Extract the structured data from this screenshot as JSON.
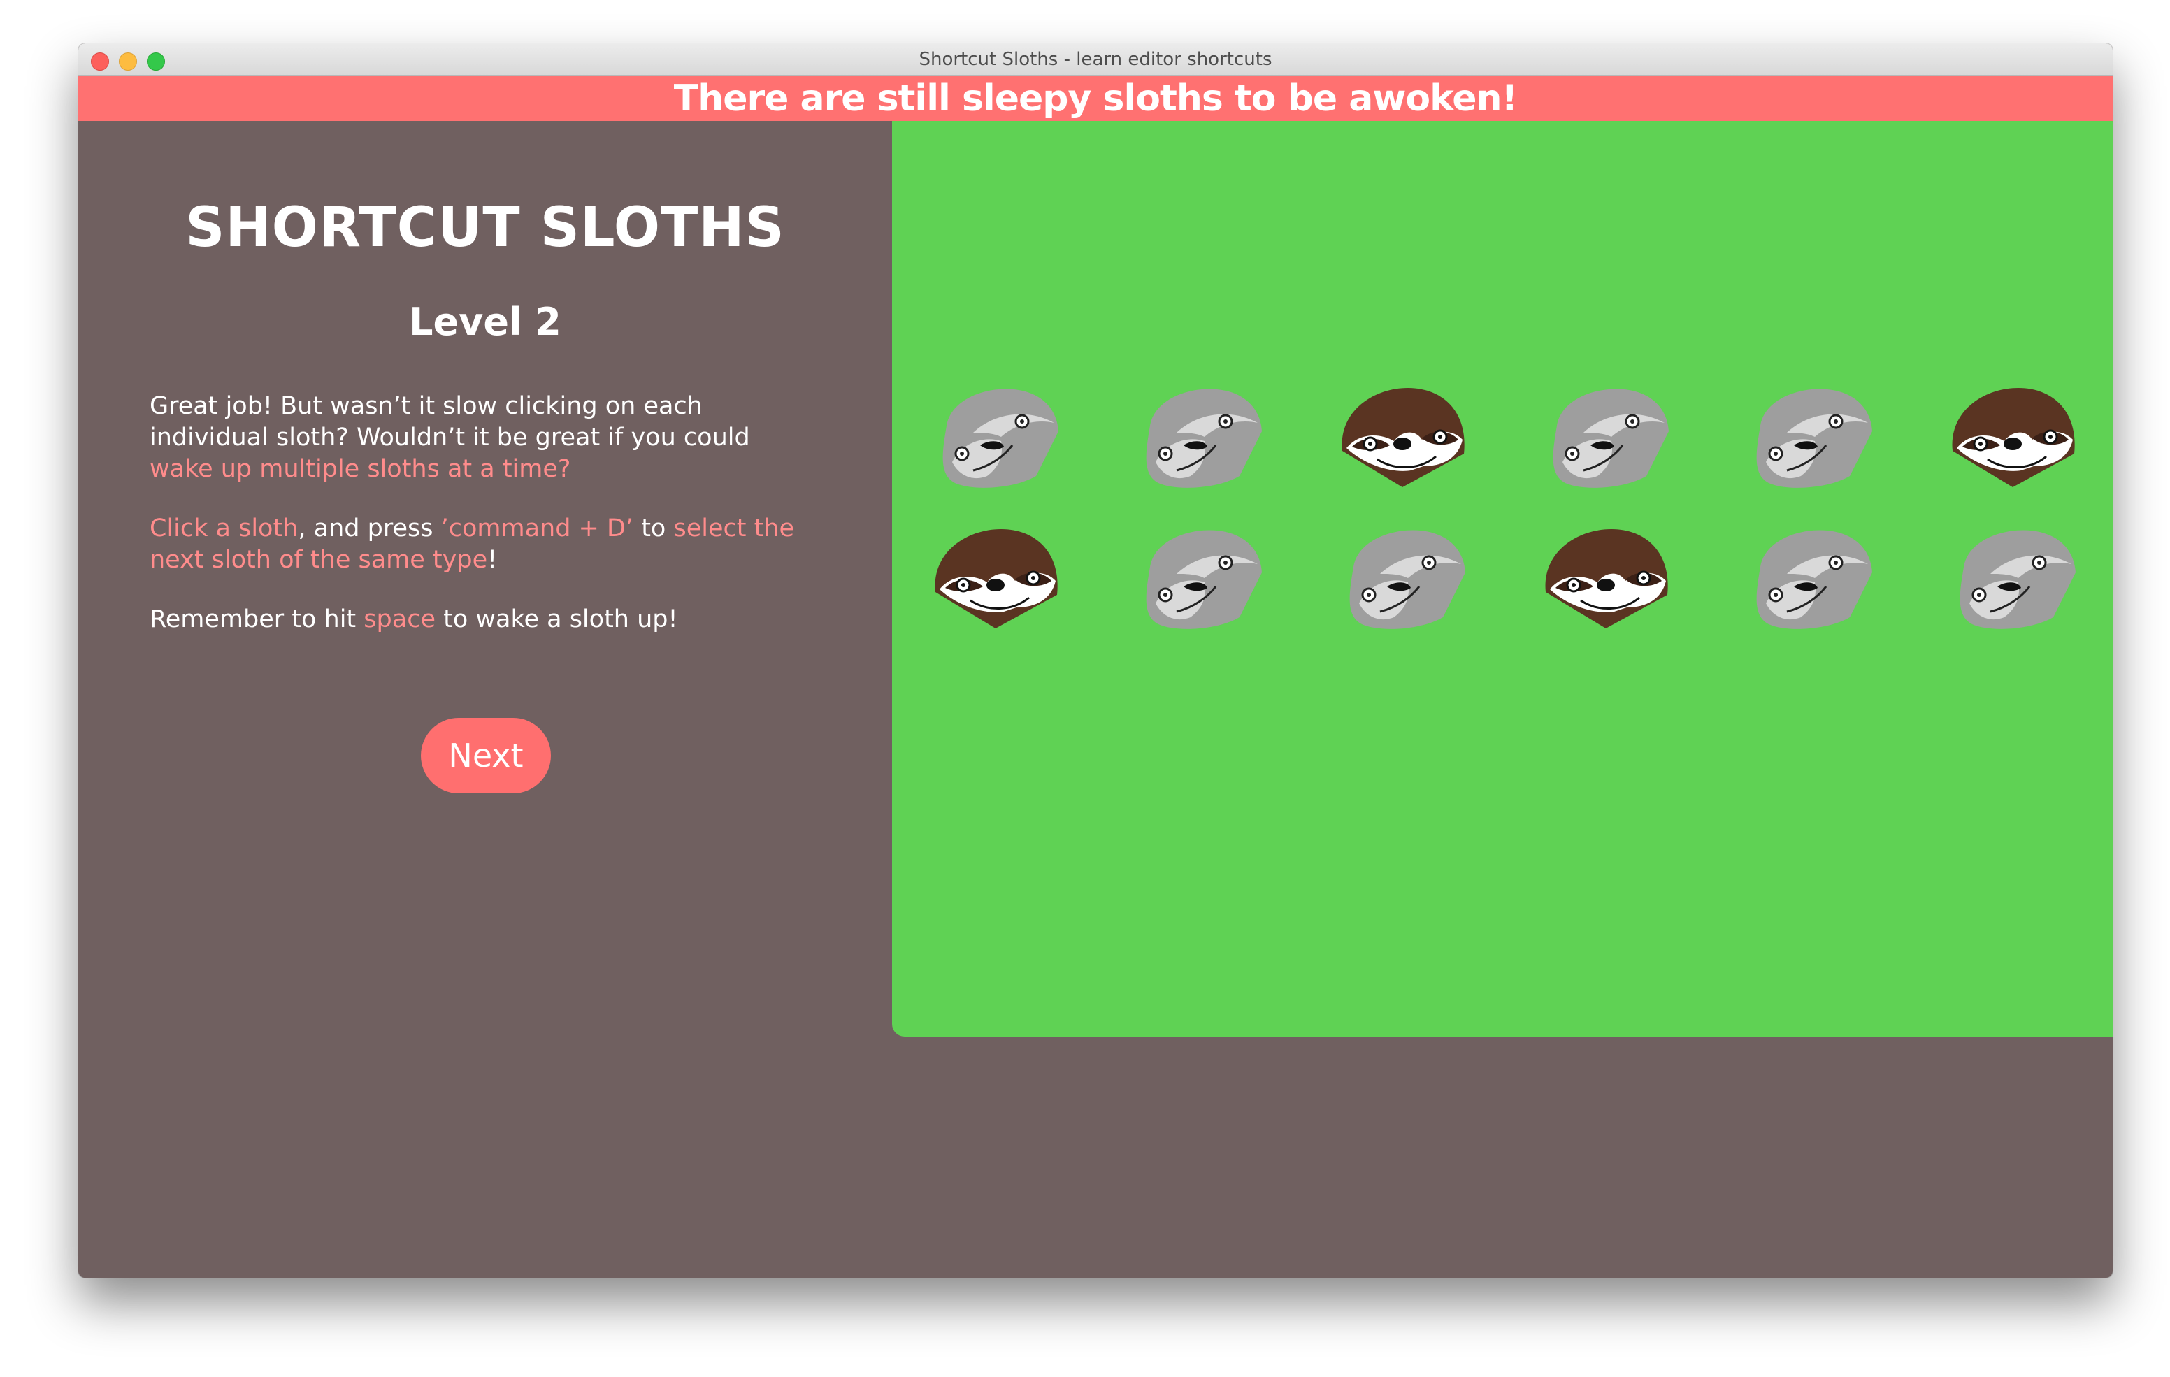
{
  "window": {
    "title": "Shortcut Sloths - learn editor shortcuts"
  },
  "banner": {
    "text": "There are still sleepy sloths to be awoken!"
  },
  "sidebar": {
    "app_title": "SHORTCUT SLOTHS",
    "level_title": "Level 2",
    "paragraph1": {
      "text_a": "Great job! But wasn’t it slow clicking on each individual sloth? Wouldn’t it be great if you could ",
      "highlight_a": "wake up multiple sloths at a time?"
    },
    "paragraph2": {
      "highlight_a": "Click a sloth",
      "text_a": ", and press ",
      "highlight_b": "’command + D’",
      "text_b": " to ",
      "highlight_c": "select the next sloth of the same type",
      "text_c": "!"
    },
    "paragraph3": {
      "text_a": "Remember to hit ",
      "highlight_a": "space",
      "text_b": " to wake a sloth up!"
    },
    "next_button_label": "Next"
  },
  "colors": {
    "banner": "#ff7171",
    "sidebar_bg": "#706060",
    "game_bg": "#5fd254",
    "highlight_text": "#ff8c8c",
    "next_button": "#ff6f6f",
    "sleepy_sloth": "#9e9e9e",
    "awake_sloth": "#5a3422"
  },
  "sloth_grid": {
    "rows": 2,
    "columns": 6,
    "sloths": [
      {
        "type": "sleepy"
      },
      {
        "type": "sleepy"
      },
      {
        "type": "awake"
      },
      {
        "type": "sleepy"
      },
      {
        "type": "sleepy"
      },
      {
        "type": "awake"
      },
      {
        "type": "awake"
      },
      {
        "type": "sleepy"
      },
      {
        "type": "sleepy"
      },
      {
        "type": "awake"
      },
      {
        "type": "sleepy"
      },
      {
        "type": "sleepy"
      }
    ]
  }
}
